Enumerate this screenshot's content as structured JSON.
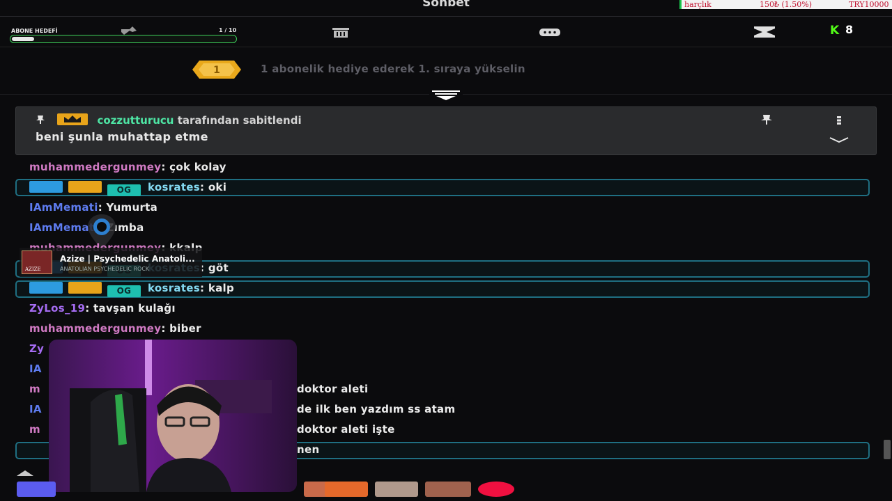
{
  "header": {
    "title": "Sohbet"
  },
  "ticker": {
    "label": "harçlık",
    "amount": "150₺ (1.50%)",
    "goal": "TRY10000"
  },
  "toolbar": {
    "goal_label": "ABONE HEDEFİ",
    "goal_count": "1 / 10",
    "goal_progress": 0.1,
    "kick_count": "8"
  },
  "gift_banner": {
    "badge": "1",
    "text": "1 abonelik hediye ederek 1. sıraya yükselin"
  },
  "pinned": {
    "user": "cozzutturucu",
    "suffix": "tarafından sabitlendi",
    "message": "beni şunla muhattap etme"
  },
  "messages": [
    {
      "user": "muhammedergunmey",
      "text": ": çok kolay"
    },
    {
      "user": "kosrates",
      "text": ": oki"
    },
    {
      "user": "IAmMemati",
      "text": ": Yumurta"
    },
    {
      "user": "IAmMemati",
      "text": ": Zımba"
    },
    {
      "user": "muhammedergunmey",
      "text": ": kkalp"
    },
    {
      "user": "kosrates",
      "text": ": göt"
    },
    {
      "user": "kosrates",
      "text": ": kalp"
    },
    {
      "user": "ZyLos_19",
      "text": ": tavşan kulağı"
    },
    {
      "user": "muhammedergunmey",
      "text": ": biber"
    },
    {
      "user": "Zy",
      "text": ""
    },
    {
      "user": "IA",
      "text": ""
    },
    {
      "user": "m",
      "text": "doktor aleti"
    },
    {
      "user": "IA",
      "text": "de ilk ben yazdım ss atam"
    },
    {
      "user": "m",
      "text": "doktor aleti işte"
    },
    {
      "user": "",
      "text": "nen"
    }
  ],
  "now_playing": {
    "title": "Azize | Psychedelic Anatoli...",
    "subtitle": "ANATOLIAN PSYCHEDELIC ROCK",
    "art_text": "AZIZE"
  },
  "colors": {
    "kick_green": "#53fc18",
    "moderator": "#2d9be0",
    "vip": "#e8a41a",
    "og": "#1ebfb0",
    "highlight_border": "#1f6f82"
  }
}
